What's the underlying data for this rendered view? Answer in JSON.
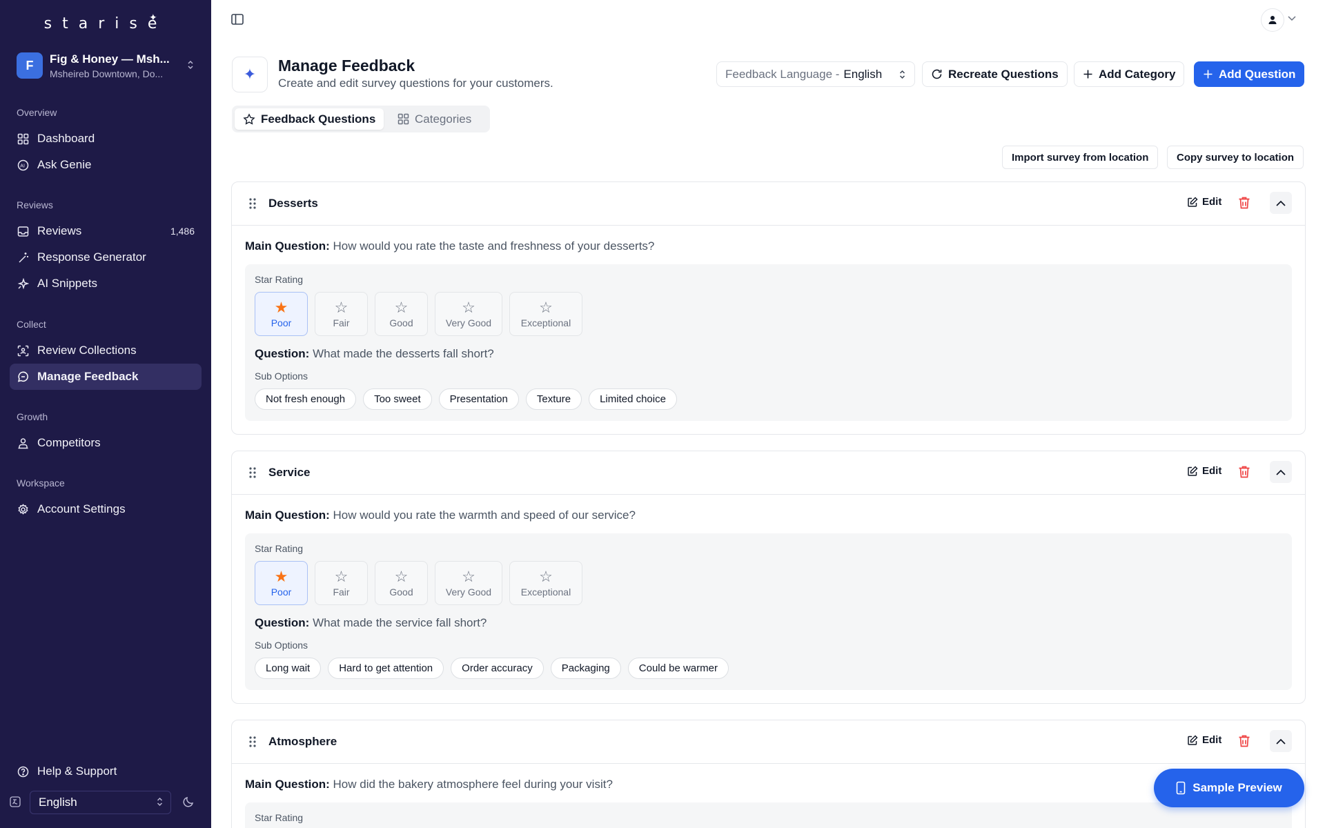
{
  "app": {
    "logo": "starise"
  },
  "org": {
    "initial": "F",
    "name": "Fig & Honey — Msh...",
    "location": "Msheireb Downtown, Do..."
  },
  "sidebar": {
    "sections": [
      {
        "label": "Overview",
        "items": [
          {
            "label": "Dashboard",
            "icon": "grid-icon"
          },
          {
            "label": "Ask Genie",
            "icon": "ai-icon"
          }
        ]
      },
      {
        "label": "Reviews",
        "items": [
          {
            "label": "Reviews",
            "icon": "inbox-icon",
            "count": "1,486"
          },
          {
            "label": "Response Generator",
            "icon": "wand-icon"
          },
          {
            "label": "AI Snippets",
            "icon": "sparkle-icon"
          }
        ]
      },
      {
        "label": "Collect",
        "items": [
          {
            "label": "Review Collections",
            "icon": "scan-icon"
          },
          {
            "label": "Manage Feedback",
            "icon": "chat-icon",
            "active": true
          }
        ]
      },
      {
        "label": "Growth",
        "items": [
          {
            "label": "Competitors",
            "icon": "person-icon"
          }
        ]
      },
      {
        "label": "Workspace",
        "items": [
          {
            "label": "Account Settings",
            "icon": "gear-icon"
          }
        ]
      }
    ],
    "help": "Help & Support",
    "language": "English"
  },
  "header": {
    "title": "Manage Feedback",
    "subtitle": "Create and edit survey questions for your customers.",
    "language_prefix": "Feedback Language -",
    "language_value": "English",
    "recreate": "Recreate Questions",
    "add_category": "Add Category",
    "add_question": "Add Question"
  },
  "tabs": {
    "questions": "Feedback Questions",
    "categories": "Categories"
  },
  "actions": {
    "import": "Import survey from location",
    "copy": "Copy survey to location"
  },
  "labels": {
    "main_question": "Main Question:",
    "question": "Question:",
    "star_rating": "Star Rating",
    "sub_options": "Sub Options",
    "edit": "Edit"
  },
  "rating_options": [
    "Poor",
    "Fair",
    "Good",
    "Very Good",
    "Exceptional"
  ],
  "categories": [
    {
      "name": "Desserts",
      "main_question": "How would you rate the taste and freshness of your desserts?",
      "question": "What made the desserts fall short?",
      "sub_options": [
        "Not fresh enough",
        "Too sweet",
        "Presentation",
        "Texture",
        "Limited choice"
      ]
    },
    {
      "name": "Service",
      "main_question": "How would you rate the warmth and speed of our service?",
      "question": "What made the service fall short?",
      "sub_options": [
        "Long wait",
        "Hard to get attention",
        "Order accuracy",
        "Packaging",
        "Could be warmer"
      ]
    },
    {
      "name": "Atmosphere",
      "main_question": "How did the bakery atmosphere feel during your visit?"
    }
  ],
  "preview": "Sample Preview",
  "colors": {
    "sidebar": "#1e1a47",
    "accent": "#2563eb",
    "star_selected": "#f97316",
    "danger": "#ef4444"
  }
}
